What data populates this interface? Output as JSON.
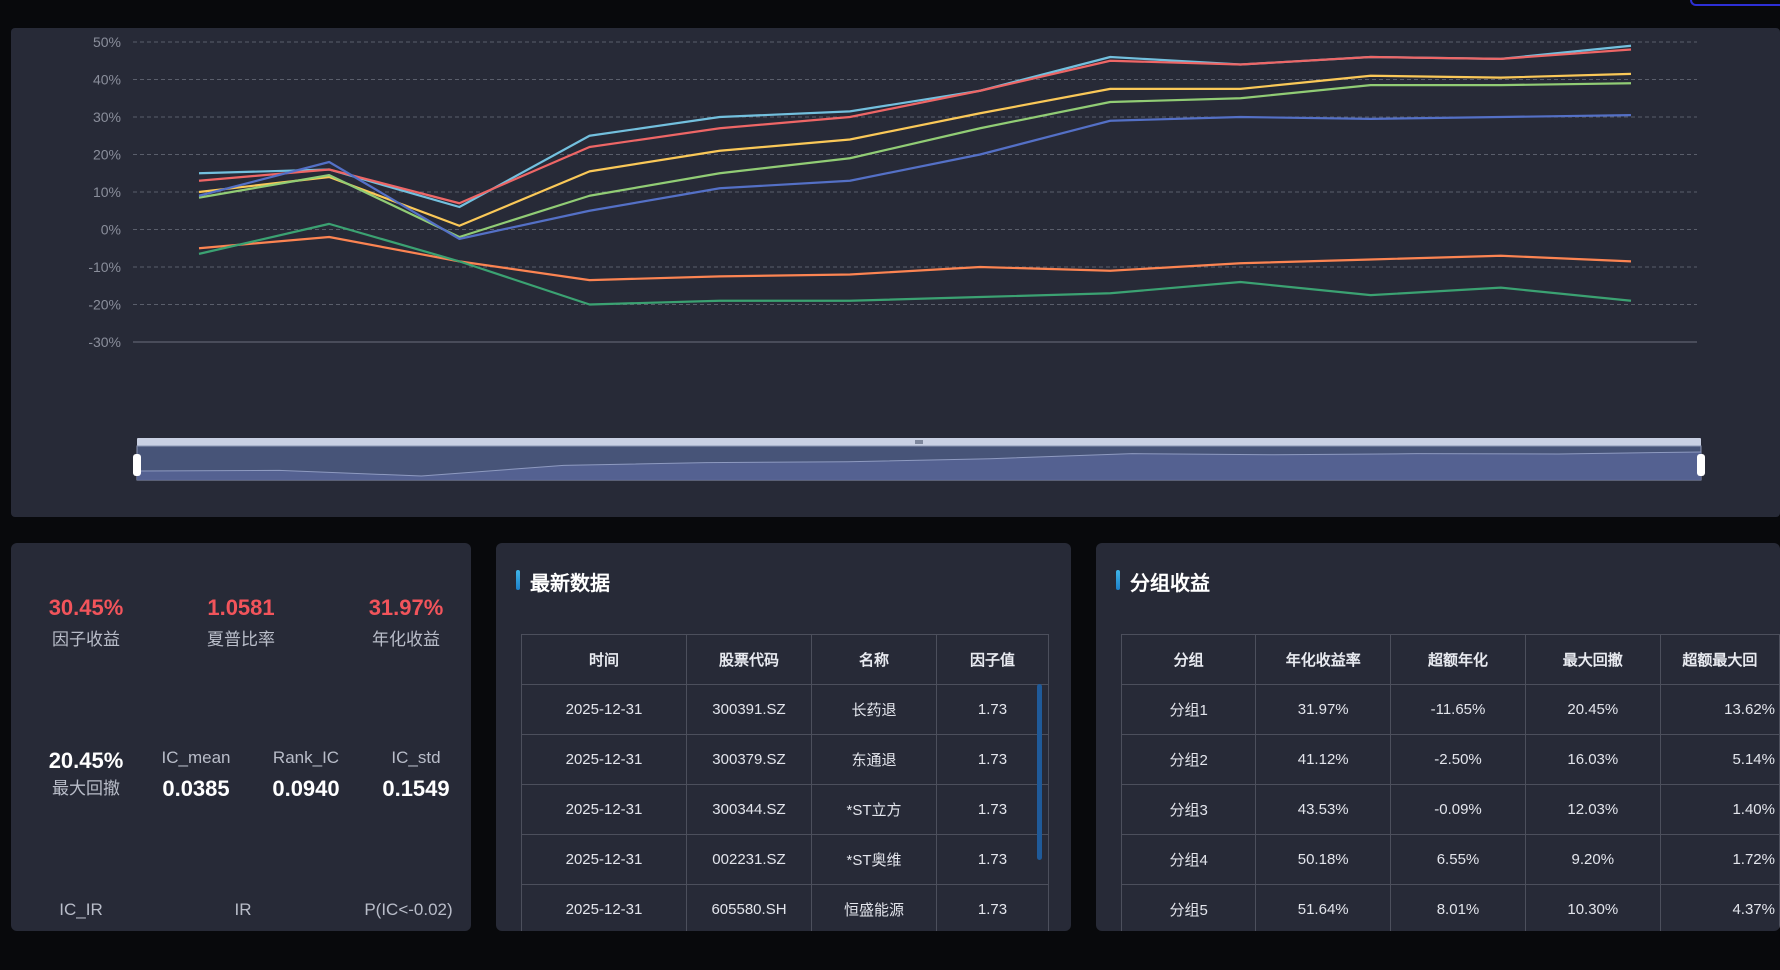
{
  "chart_data": {
    "type": "line",
    "x_count": 12,
    "yticks": [
      "50%",
      "40%",
      "30%",
      "20%",
      "10%",
      "0%",
      "-10%",
      "-20%",
      "-30%"
    ],
    "ylim": [
      -30,
      50
    ],
    "grid": true,
    "series": [
      {
        "color": "#73c0de",
        "values": [
          15,
          16,
          6,
          25,
          30,
          31.5,
          37,
          46,
          44,
          46,
          45.5,
          49
        ]
      },
      {
        "color": "#ee6666",
        "values": [
          13,
          16,
          7,
          22,
          27,
          30,
          37,
          45,
          44,
          46,
          45.5,
          48
        ]
      },
      {
        "color": "#fac858",
        "values": [
          10,
          14,
          1,
          15.5,
          21,
          24,
          31,
          37.5,
          37.5,
          41,
          40.5,
          41.5
        ]
      },
      {
        "color": "#91cc75",
        "values": [
          8.5,
          14.5,
          -2,
          9,
          15,
          19,
          27,
          34,
          35,
          38.5,
          38.5,
          39
        ]
      },
      {
        "color": "#5470c6",
        "values": [
          9,
          18,
          -2.5,
          5,
          11,
          13,
          20,
          29,
          30,
          29.5,
          30,
          30.5
        ]
      },
      {
        "color": "#fc8452",
        "values": [
          -5,
          -2,
          -8.5,
          -13.5,
          -12.5,
          -12,
          -10,
          -11,
          -9,
          -8,
          -7,
          -8.5
        ]
      },
      {
        "color": "#3ba272",
        "values": [
          -6.5,
          1.5,
          -8.5,
          -20,
          -19,
          -19,
          -18,
          -17,
          -14,
          -17.5,
          -15.5,
          -19
        ]
      }
    ]
  },
  "stats": {
    "factor_return": {
      "value": "30.45%",
      "label": "因子收益"
    },
    "sharpe": {
      "value": "1.0581",
      "label": "夏普比率"
    },
    "annual_return": {
      "value": "31.97%",
      "label": "年化收益"
    },
    "max_drawdown": {
      "value": "20.45%",
      "label": "最大回撤"
    },
    "ic_mean": {
      "label": "IC_mean",
      "value": "0.0385"
    },
    "rank_ic": {
      "label": "Rank_IC",
      "value": "0.0940"
    },
    "ic_std": {
      "label": "IC_std",
      "value": "0.1549"
    },
    "ic_ir": {
      "label": "IC_IR"
    },
    "ir": {
      "label": "IR"
    },
    "p_ic": {
      "label": "P(IC<-0.02)"
    }
  },
  "latest": {
    "title": "最新数据",
    "headers": [
      "时间",
      "股票代码",
      "名称",
      "因子值"
    ],
    "rows": [
      [
        "2025-12-31",
        "300391.SZ",
        "长药退",
        "1.73"
      ],
      [
        "2025-12-31",
        "300379.SZ",
        "东通退",
        "1.73"
      ],
      [
        "2025-12-31",
        "300344.SZ",
        "*ST立方",
        "1.73"
      ],
      [
        "2025-12-31",
        "002231.SZ",
        "*ST奥维",
        "1.73"
      ],
      [
        "2025-12-31",
        "605580.SH",
        "恒盛能源",
        "1.73"
      ]
    ]
  },
  "groups": {
    "title": "分组收益",
    "headers": [
      "分组",
      "年化收益率",
      "超额年化",
      "最大回撤",
      "超额最大回"
    ],
    "rows": [
      [
        "分组1",
        "31.97%",
        "-11.65%",
        "20.45%",
        "13.62%"
      ],
      [
        "分组2",
        "41.12%",
        "-2.50%",
        "16.03%",
        "5.14%"
      ],
      [
        "分组3",
        "43.53%",
        "-0.09%",
        "12.03%",
        "1.40%"
      ],
      [
        "分组4",
        "50.18%",
        "6.55%",
        "9.20%",
        "1.72%"
      ],
      [
        "分组5",
        "51.64%",
        "8.01%",
        "10.30%",
        "4.37%"
      ]
    ]
  }
}
